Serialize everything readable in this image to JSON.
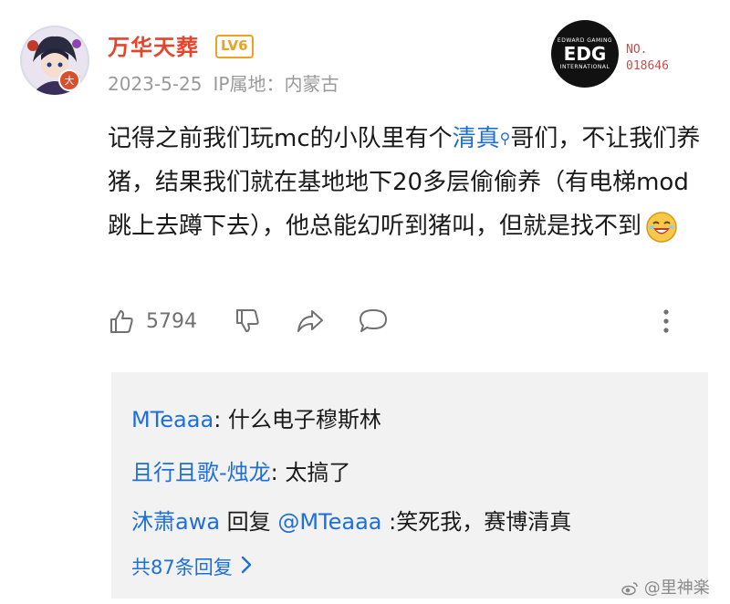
{
  "post": {
    "author": {
      "name": "万华天葬",
      "level": "LV6",
      "avatar_badge": "大"
    },
    "date": "2023-5-25",
    "ip_location": "IP属地：内蒙古",
    "badge": {
      "logo_top": "EDWARD GAMING",
      "logo_text": "EDG",
      "logo_bottom": "INTERNATIONAL",
      "no_label": "NO.",
      "no_value": "018646"
    },
    "content": {
      "part1": "记得之前我们玩mc的小队里有个",
      "topic": "清真",
      "part2": "哥们，不让我们养猪，结果我们就在基地地下20多层偷偷养（有电梯mod跳上去蹲下去），他总能幻听到猪叫，但就是找不到"
    },
    "likes": "5794"
  },
  "replies": [
    {
      "name": "MTeaaa",
      "sep": ": ",
      "text": "什么电子穆斯林"
    },
    {
      "name": "且行且歌-烛龙",
      "sep": ": ",
      "text": "太搞了"
    },
    {
      "name": "沐萧awa",
      "mid": " 回复 ",
      "target": "@MTeaaa",
      "sep": " :",
      "text": "笑死我，赛博清真"
    }
  ],
  "more_replies": "共87条回复",
  "watermark": "@里神楽",
  "colors": {
    "username": "#e8442c",
    "link": "#1e6fd9",
    "level": "#f0a020",
    "meta": "#9a9a9a",
    "reply_bg": "#f2f2f2"
  },
  "icons": [
    "like-icon",
    "dislike-icon",
    "share-icon",
    "comment-icon",
    "more-icon",
    "search-icon",
    "chevron-right-icon"
  ]
}
